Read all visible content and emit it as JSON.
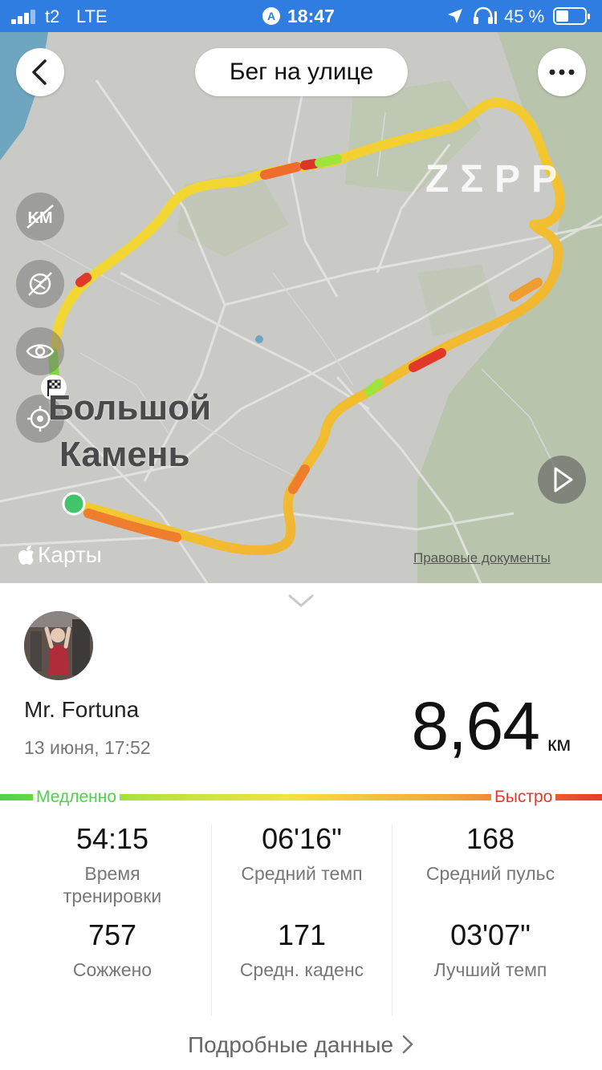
{
  "status_bar": {
    "carrier": "t2",
    "network": "LTE",
    "time": "18:47",
    "battery": "45 %",
    "battery_level": 0.45
  },
  "map": {
    "title": "Бег на улице",
    "watermark": "ZΣPP",
    "place_name_line1": "Большой",
    "place_name_line2": "Камень",
    "provider": "Карты",
    "legal_link": "Правовые документы",
    "tools": [
      "km-markers-icon",
      "map-layer-icon",
      "visibility-icon",
      "recenter-icon"
    ]
  },
  "summary": {
    "user_name": "Mr. Fortuna",
    "date": "13 июня, 17:52",
    "distance": "8,64",
    "distance_unit": "км"
  },
  "pace_legend": {
    "slow": "Медленно",
    "fast": "Быстро",
    "colors": [
      "#4fd24b",
      "#f3e33c",
      "#e93a2a"
    ]
  },
  "stats": [
    {
      "value": "54:15",
      "label": "Время тренировки"
    },
    {
      "value": "06'16\"",
      "label": "Средний темп"
    },
    {
      "value": "168",
      "label": "Средний пульс"
    },
    {
      "value": "757",
      "label": "Сожжено"
    },
    {
      "value": "171",
      "label": "Средн. каденс"
    },
    {
      "value": "03'07\"",
      "label": "Лучший темп"
    }
  ],
  "details_link": "Подробные данные"
}
